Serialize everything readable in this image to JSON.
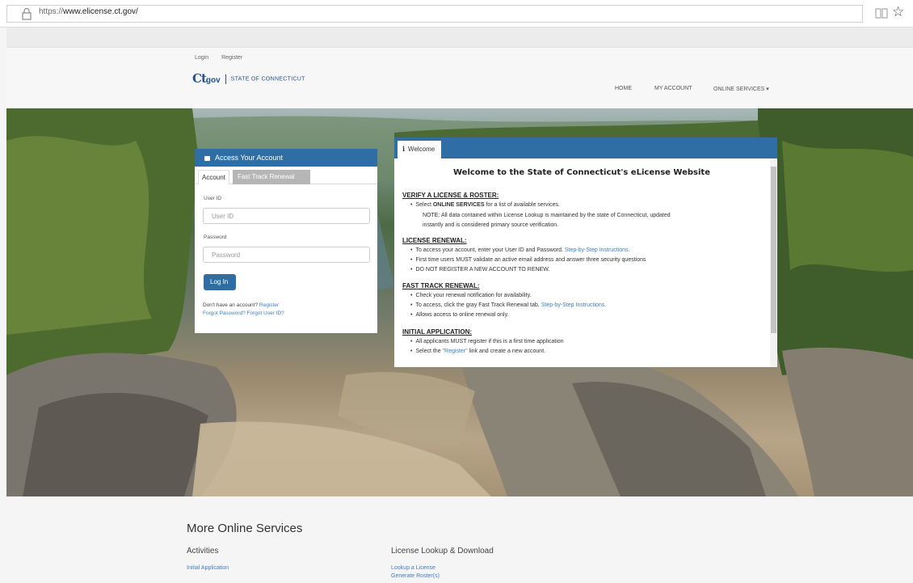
{
  "browser": {
    "url_prefix": "https://",
    "url_host": "www.elicense.ct.gov/"
  },
  "header": {
    "login_link": "Login",
    "register_link": "Register",
    "logo_ct": "Ct",
    "logo_gov": "gov",
    "logo_state": "STATE OF CONNECTICUT",
    "nav": {
      "home": "HOME",
      "my_account": "MY ACCOUNT",
      "online_services": "ONLINE SERVICES ▾"
    }
  },
  "login_panel": {
    "title": "Access Your Account",
    "tab_account": "Account",
    "tab_fast_track": "Fast Track Renewal",
    "user_id_label": "User ID",
    "user_id_placeholder": "User ID",
    "password_label": "Password",
    "password_placeholder": "Password",
    "login_button": "Log In",
    "no_account_text": "Don't have an account?",
    "register_link": "Register",
    "forgot_links": "Forgot Password? Forgot User ID?"
  },
  "welcome_panel": {
    "tab_label": "Welcome",
    "title": "Welcome to the State of Connecticut's eLicense Website",
    "verify_heading": "VERIFY A LICENSE & ROSTER:",
    "verify_b1_pre": "Select ",
    "verify_b1_bold": "ONLINE SERVICES",
    "verify_b1_post": " for a list of available services.",
    "verify_note_1": "NOTE: All data contained within License Lookup is maintained by the state of Connecticut, updated",
    "verify_note_2": "instantly and is considered primary source verification.",
    "renewal_heading": "LICENSE RENEWAL:",
    "renewal_b1": "To access your account, enter your User ID and Password.",
    "renewal_b1_link": "Step-by-Step Instructions.",
    "renewal_b2": "First time users MUST validate an active email address and answer three security questions",
    "renewal_b3": "DO NOT REGISTER A NEW ACCOUNT TO RENEW.",
    "fast_heading": "FAST TRACK RENEWAL:",
    "fast_b1": "Check your renewal notification for availability.",
    "fast_b2": "To access, click the gray Fast Track Renewal tab.",
    "fast_b2_link": "Step-by-Step Instructions.",
    "fast_b3": "Allows access to online renewal only.",
    "initial_heading": "INITIAL APPLICATION:",
    "initial_b1": "All applicants MUST register if this is a first time application",
    "initial_b2_pre": "Select the ",
    "initial_b2_link": "\"Register\"",
    "initial_b2_post": " link and create a new account."
  },
  "more_services": {
    "title": "More Online Services",
    "activities_heading": "Activities",
    "activities_links": [
      "Initial Application"
    ],
    "lookup_heading": "License Lookup & Download",
    "lookup_links": [
      "Lookup a License",
      "Generate Roster(s)"
    ]
  }
}
